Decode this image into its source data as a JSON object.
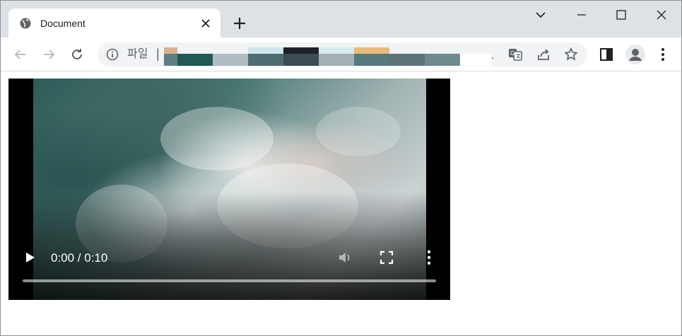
{
  "tab": {
    "title": "Document",
    "icon": "globe-icon"
  },
  "toolbar": {
    "address_scheme": "파일",
    "address_separator": "|",
    "address_trailing": "."
  },
  "video": {
    "current_time": "0:00",
    "duration": "0:10",
    "time_display": "0:00 / 0:10",
    "progress": 0.0,
    "state": "paused"
  },
  "colors": {
    "tabstrip_bg": "#dee1e6",
    "omnibox_bg": "#f1f3f4",
    "icon_gray": "#5f6368"
  }
}
